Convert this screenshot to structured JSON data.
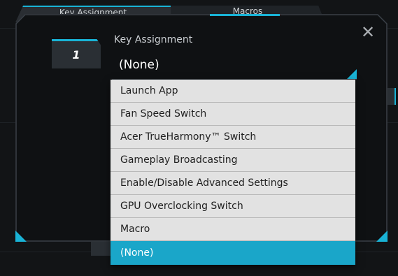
{
  "tabs": [
    {
      "label": "Key Assignment"
    },
    {
      "label": "Macros"
    }
  ],
  "dialog": {
    "key_badge": "1",
    "field_label": "Key Assignment",
    "selected_value": "(None)",
    "close_icon": "close-icon"
  },
  "dropdown": {
    "options": [
      {
        "label": "Launch App"
      },
      {
        "label": "Fan Speed Switch"
      },
      {
        "label": "Acer TrueHarmony™ Switch"
      },
      {
        "label": "Gameplay Broadcasting"
      },
      {
        "label": "Enable/Disable Advanced Settings"
      },
      {
        "label": "GPU Overclocking Switch"
      },
      {
        "label": "Macro"
      },
      {
        "label": "(None)"
      }
    ],
    "selected_index": 7
  },
  "colors": {
    "accent": "#19b3d6",
    "selected_row": "#1aa6c9",
    "background": "#121416",
    "dropdown_bg": "#e2e2e2"
  }
}
